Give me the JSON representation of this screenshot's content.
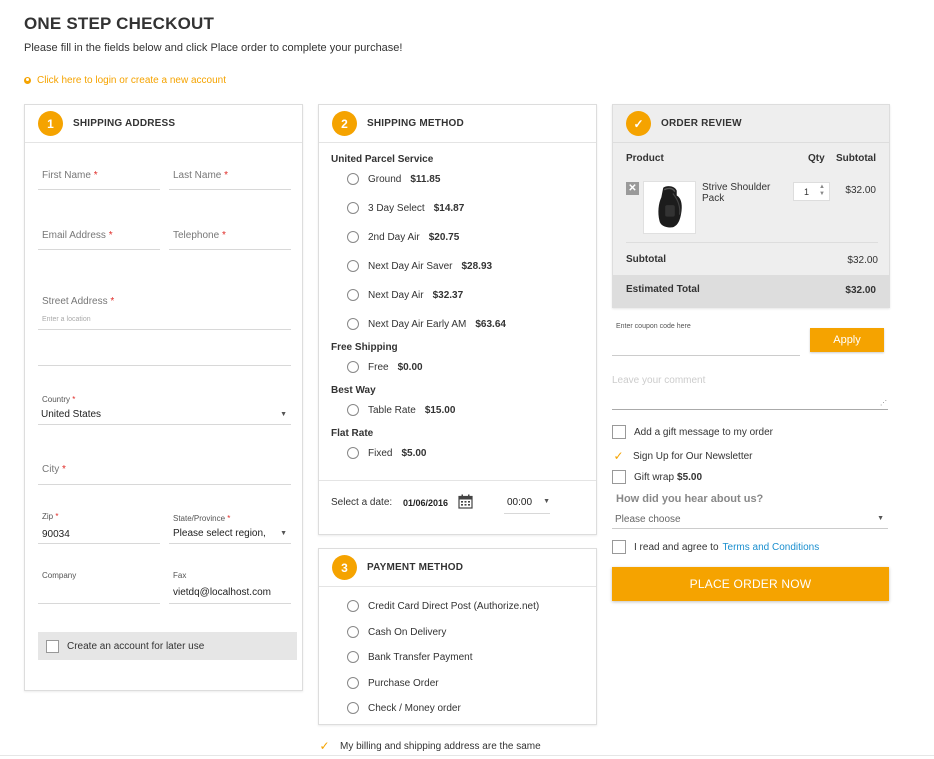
{
  "header": {
    "title": "ONE STEP CHECKOUT",
    "subtitle": "Please fill in the fields below and click Place order to complete your purchase!",
    "login_link": "Click here to login or create a new account"
  },
  "colors": {
    "accent": "#f5a300",
    "required": "#e02b27",
    "link": "#1a8fcf"
  },
  "shipping_address": {
    "step": "1",
    "title": "SHIPPING ADDRESS",
    "first_name": {
      "label": "First Name",
      "required": "*"
    },
    "last_name": {
      "label": "Last Name",
      "required": "*"
    },
    "email": {
      "label": "Email Address",
      "required": "*"
    },
    "telephone": {
      "label": "Telephone",
      "required": "*"
    },
    "street": {
      "label": "Street Address",
      "required": "*",
      "placeholder": "Enter a location"
    },
    "country": {
      "label": "Country",
      "required": "*",
      "value": "United States"
    },
    "city": {
      "label": "City",
      "required": "*"
    },
    "zip": {
      "label": "Zip",
      "required": "*",
      "value": "90034"
    },
    "state": {
      "label": "State/Province",
      "required": "*",
      "value": "Please select region,"
    },
    "company": {
      "label": "Company"
    },
    "fax": {
      "label": "Fax",
      "value": "vietdq@localhost.com"
    },
    "create_account": "Create an account for later use"
  },
  "shipping_method": {
    "step": "2",
    "title": "SHIPPING METHOD",
    "carriers": [
      {
        "name": "United Parcel Service",
        "rates": [
          {
            "label": "Ground",
            "price": "$11.85"
          },
          {
            "label": "3 Day Select",
            "price": "$14.87"
          },
          {
            "label": "2nd Day Air",
            "price": "$20.75"
          },
          {
            "label": "Next Day Air Saver",
            "price": "$28.93"
          },
          {
            "label": "Next Day Air",
            "price": "$32.37"
          },
          {
            "label": "Next Day Air Early AM",
            "price": "$63.64"
          }
        ]
      },
      {
        "name": "Free Shipping",
        "rates": [
          {
            "label": "Free",
            "price": "$0.00"
          }
        ]
      },
      {
        "name": "Best Way",
        "rates": [
          {
            "label": "Table Rate",
            "price": "$15.00"
          }
        ]
      },
      {
        "name": "Flat Rate",
        "rates": [
          {
            "label": "Fixed",
            "price": "$5.00"
          }
        ]
      }
    ],
    "date_label": "Select a date:",
    "date_value": "01/06/2016",
    "time_value": "00:00"
  },
  "payment_method": {
    "step": "3",
    "title": "PAYMENT METHOD",
    "options": [
      "Credit Card Direct Post (Authorize.net)",
      "Cash On Delivery",
      "Bank Transfer Payment",
      "Purchase Order",
      "Check / Money order"
    ],
    "same_address": "My billing and shipping address are the same"
  },
  "order_review": {
    "step_icon": "check-icon",
    "title": "ORDER REVIEW",
    "col_product": "Product",
    "col_qty": "Qty",
    "col_subtotal": "Subtotal",
    "item": {
      "name": "Strive Shoulder Pack",
      "qty": "1",
      "price": "$32.00"
    },
    "subtotal_label": "Subtotal",
    "subtotal_value": "$32.00",
    "total_label": "Estimated Total",
    "total_value": "$32.00"
  },
  "extras": {
    "coupon_placeholder": "Enter coupon code here",
    "apply_label": "Apply",
    "comment_placeholder": "Leave your comment",
    "gift_message": "Add a gift message to my order",
    "newsletter": "Sign Up for Our Newsletter",
    "gift_wrap": "Gift wrap",
    "gift_wrap_price": "$5.00",
    "hear_label": "How did you hear about us?",
    "hear_value": "Please choose",
    "terms_prefix": "I read and agree to",
    "terms_link": "Terms and Conditions",
    "place_order": "PLACE ORDER NOW"
  }
}
